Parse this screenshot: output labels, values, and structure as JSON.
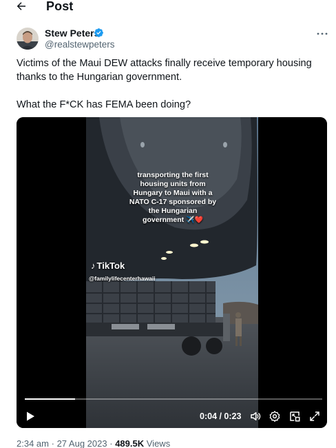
{
  "header": {
    "back_icon": "arrow-left-icon",
    "title": "Post"
  },
  "author": {
    "name": "Stew Peters",
    "handle": "@realstewpeters",
    "verified": true,
    "verified_color": "#1d9bf0"
  },
  "more_icon": "more-horizontal-icon",
  "tweet": {
    "line1": "Victims of the Maui DEW attacks finally receive temporary housing thanks to the Hungarian government.",
    "line2": "What the F*CK has FEMA been doing?"
  },
  "video": {
    "caption_lines": [
      "transporting the first",
      "housing units from",
      "Hungary to Maui with a",
      "NATO C-17 sponsored by",
      "the Hungarian",
      "government"
    ],
    "caption_emoji": "✈️❤️",
    "watermark_brand": "TikTok",
    "watermark_handle": "@familylifecenterhawaii",
    "current_time": "0:04",
    "duration": "0:23",
    "time_display": "0:04 / 0:23",
    "progress_fraction": 0.17,
    "controls": [
      "play-icon",
      "volume-icon",
      "settings-icon",
      "pip-icon",
      "fullscreen-icon"
    ]
  },
  "meta": {
    "time": "2:34 am",
    "date": "27 Aug 2023",
    "views_count": "489.5K",
    "views_label": "Views",
    "separator": "·"
  },
  "colors": {
    "text": "#0f1419",
    "secondary": "#536471",
    "accent": "#1d9bf0"
  }
}
